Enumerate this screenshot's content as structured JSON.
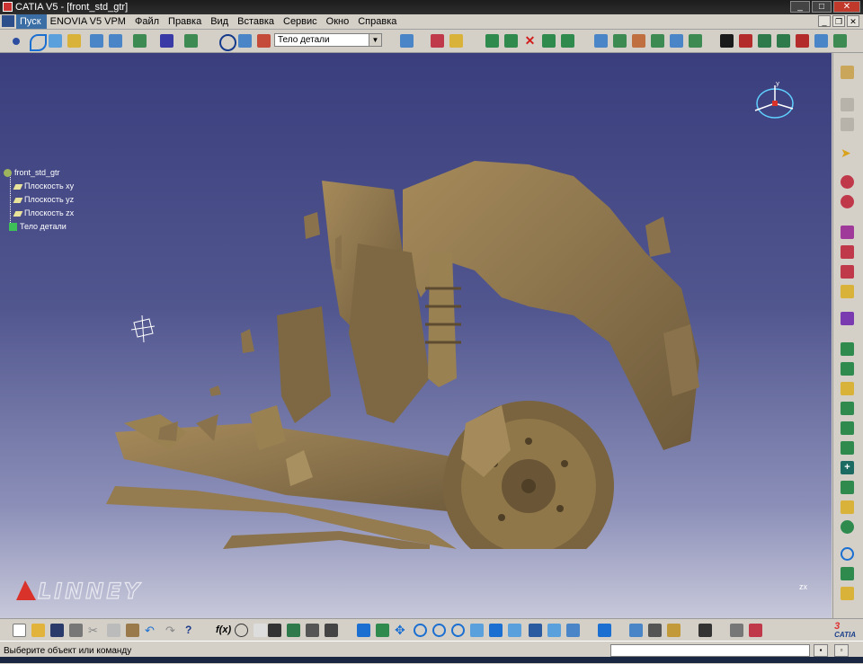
{
  "window": {
    "title": "CATIA V5 - [front_std_gtr]"
  },
  "menu": {
    "items": [
      "Пуск",
      "ENOVIA V5 VPM",
      "Файл",
      "Правка",
      "Вид",
      "Вставка",
      "Сервис",
      "Окно",
      "Справка"
    ]
  },
  "toolbar": {
    "body_select": "Тело детали"
  },
  "tree": {
    "root": "front_std_gtr",
    "plane_xy": "Плоскость xy",
    "plane_yz": "Плоскость yz",
    "plane_zx": "Плоскость zx",
    "body": "Тело детали"
  },
  "viewport": {
    "compass_y": "y",
    "axis_label": "z",
    "axis_label2": "x",
    "logo_text": "LINNEY"
  },
  "bottom": {
    "brand": "CATIA"
  },
  "status": {
    "message": "Выберите объект или команду"
  },
  "colors": {
    "viewport_top": "#3a3e7d",
    "viewport_bottom": "#c7c8da",
    "model": "#8a734c",
    "tree_text": "#ffffff",
    "menu_active": "#3a6ea5",
    "logo_red": "#d8322a"
  }
}
